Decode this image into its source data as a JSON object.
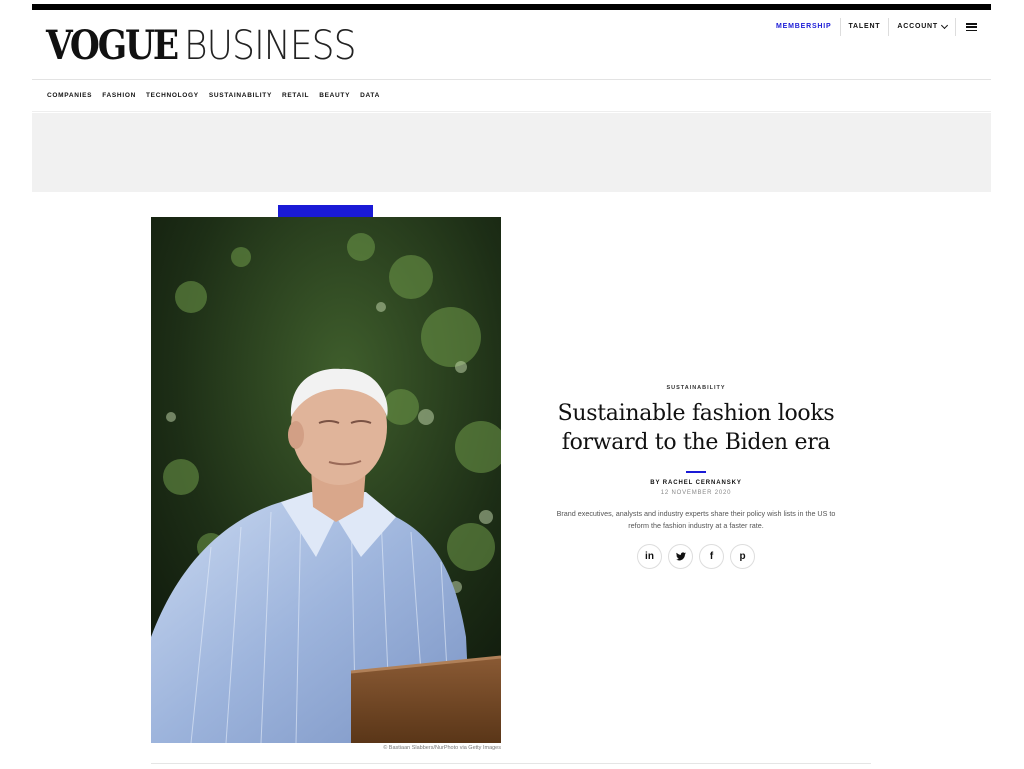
{
  "brand": {
    "logo_primary": "VOGUE",
    "logo_secondary": "BUSINESS",
    "accent_color": "#1a1ad6"
  },
  "top_nav": {
    "membership": "MEMBERSHIP",
    "talent": "TALENT",
    "account": "ACCOUNT",
    "account_icon": "chevron-down-icon",
    "menu_icon": "hamburger-menu-icon"
  },
  "category_nav": [
    {
      "label": "COMPANIES"
    },
    {
      "label": "FASHION"
    },
    {
      "label": "TECHNOLOGY"
    },
    {
      "label": "SUSTAINABILITY"
    },
    {
      "label": "RETAIL"
    },
    {
      "label": "BEAUTY"
    },
    {
      "label": "DATA"
    }
  ],
  "hero": {
    "photo_credit": "© Bastiaan Slabbers/NurPhoto via Getty Images"
  },
  "article": {
    "kicker": "SUSTAINABILITY",
    "headline": "Sustainable fashion looks forward to the Biden era",
    "byline": "BY RACHEL CERNANSKY",
    "date": "12 NOVEMBER 2020",
    "dek": "Brand executives, analysts and industry experts share their policy wish lists in the US to reform the fashion industry at a faster rate."
  },
  "share": [
    {
      "icon": "linkedin-icon",
      "glyph": "in"
    },
    {
      "icon": "twitter-icon",
      "glyph": "t"
    },
    {
      "icon": "facebook-icon",
      "glyph": "f"
    },
    {
      "icon": "pinterest-icon",
      "glyph": "p"
    }
  ]
}
